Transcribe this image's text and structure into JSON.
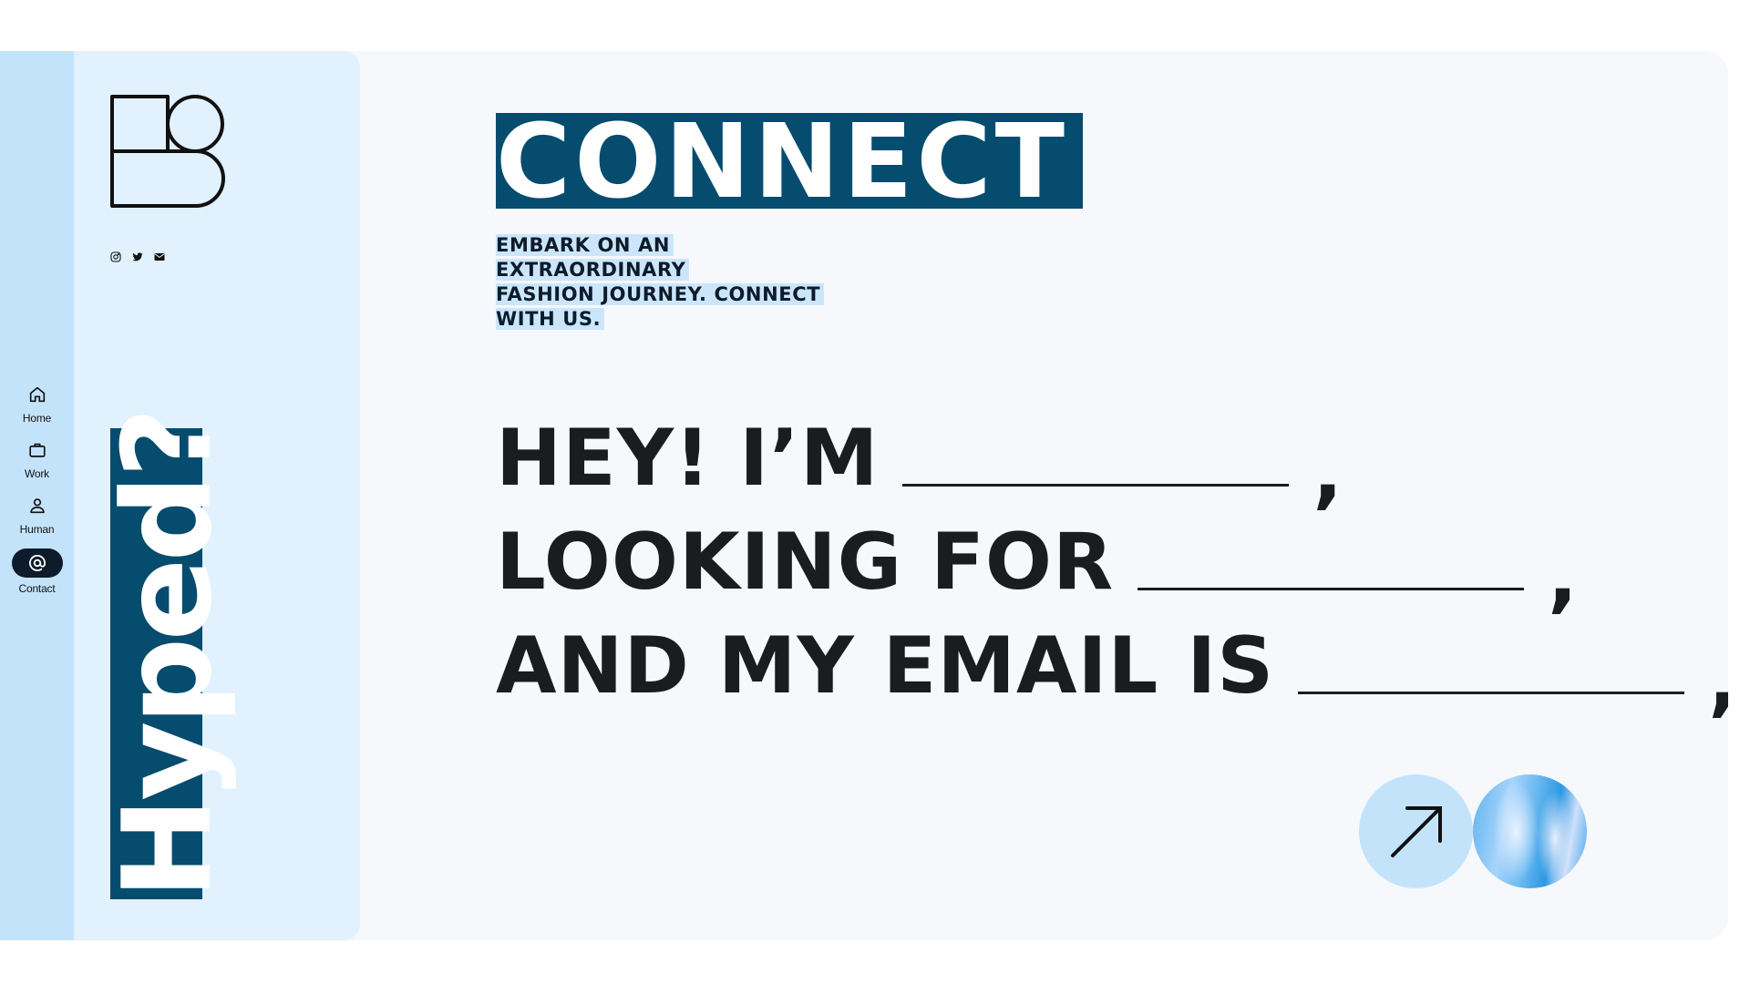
{
  "nav": {
    "items": [
      {
        "label": "Home",
        "icon": "home-icon"
      },
      {
        "label": "Work",
        "icon": "briefcase-icon"
      },
      {
        "label": "Human",
        "icon": "person-icon"
      },
      {
        "label": "Contact",
        "icon": "at-icon",
        "active": true
      }
    ]
  },
  "brand": {
    "logo": "B-monogram-logo",
    "socials": [
      "instagram-icon",
      "twitter-icon",
      "mail-icon"
    ],
    "tagline": "Hyped?"
  },
  "main": {
    "title": "CONNECT",
    "subtitle_lines": [
      "EMBARK ON AN EXTRAORDINARY",
      "FASHION JOURNEY. CONNECT",
      "WITH US."
    ],
    "form": {
      "line1_prefix": "HEY! I’M",
      "line2_prefix": "LOOKING FOR",
      "line3_prefix": "AND MY EMAIL IS",
      "comma": ",",
      "name_value": "",
      "looking_for_value": "",
      "email_value": ""
    },
    "submit_icon": "arrow-up-right-icon"
  },
  "colors": {
    "accent_dark": "#064c6e",
    "rail": "#c3e3fb",
    "panel": "#e1f1fd",
    "highlight": "#cbe6fb"
  }
}
